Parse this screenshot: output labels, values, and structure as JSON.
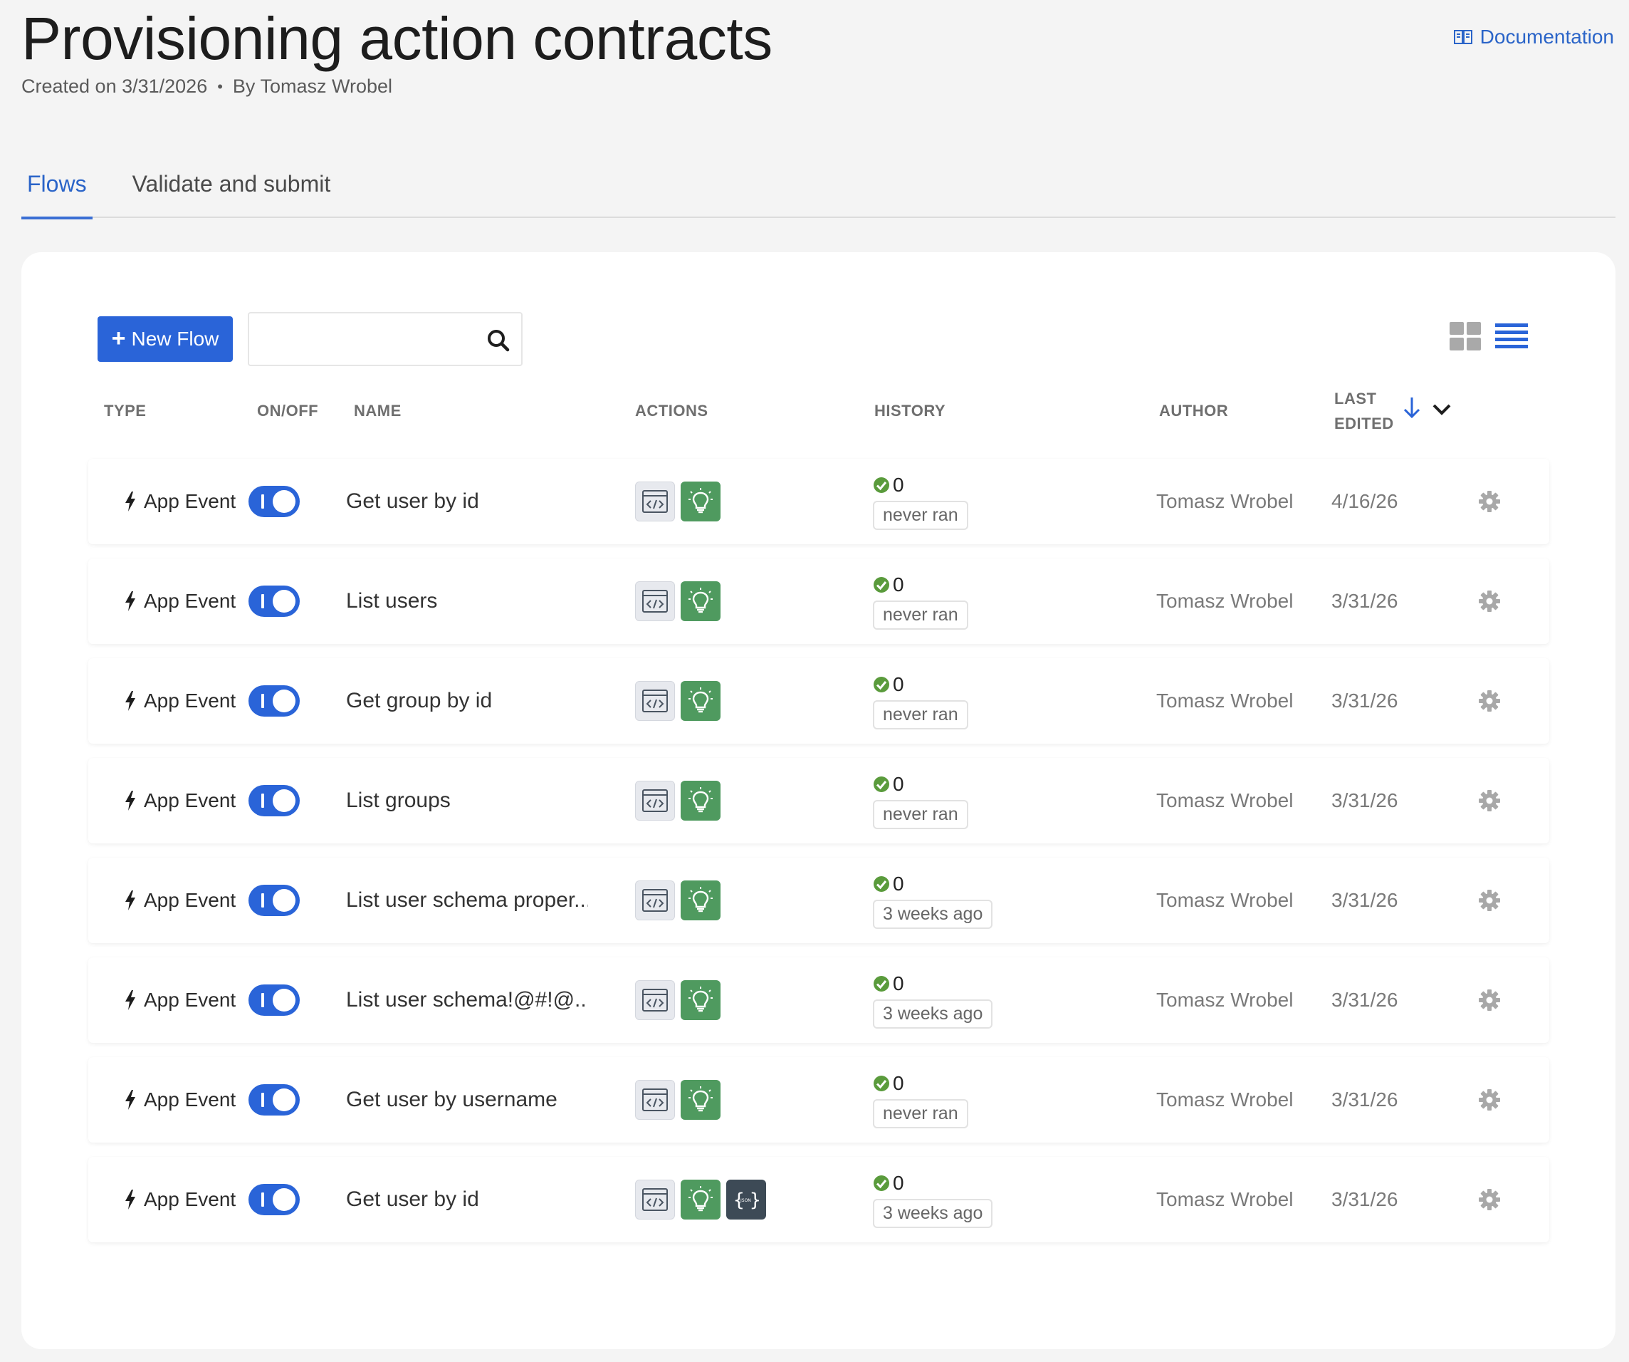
{
  "header": {
    "title": "Provisioning action contracts",
    "created": "Created on 3/31/2026",
    "separator": "•",
    "author": "By Tomasz Wrobel",
    "doc_link": "Documentation"
  },
  "tabs": [
    {
      "label": "Flows",
      "active": true
    },
    {
      "label": "Validate and submit",
      "active": false
    }
  ],
  "toolbar": {
    "new_flow_label": "New Flow",
    "search_placeholder": "",
    "view_mode": "list"
  },
  "table": {
    "columns": {
      "type": "TYPE",
      "onoff": "ON/OFF",
      "name": "NAME",
      "actions": "ACTIONS",
      "history": "HISTORY",
      "author": "AUTHOR",
      "last_edited_line1": "LAST",
      "last_edited_line2": "EDITED"
    },
    "sort": {
      "column": "last_edited",
      "direction": "desc"
    },
    "rows": [
      {
        "type": "App Event",
        "enabled": true,
        "name": "Get user by id",
        "actions": [
          "code",
          "bulb"
        ],
        "count": "0",
        "status": "never ran",
        "author": "Tomasz Wrobel",
        "edited": "4/16/26"
      },
      {
        "type": "App Event",
        "enabled": true,
        "name": "List users",
        "actions": [
          "code",
          "bulb"
        ],
        "count": "0",
        "status": "never ran",
        "author": "Tomasz Wrobel",
        "edited": "3/31/26"
      },
      {
        "type": "App Event",
        "enabled": true,
        "name": "Get group by id",
        "actions": [
          "code",
          "bulb"
        ],
        "count": "0",
        "status": "never ran",
        "author": "Tomasz Wrobel",
        "edited": "3/31/26"
      },
      {
        "type": "App Event",
        "enabled": true,
        "name": "List groups",
        "actions": [
          "code",
          "bulb"
        ],
        "count": "0",
        "status": "never ran",
        "author": "Tomasz Wrobel",
        "edited": "3/31/26"
      },
      {
        "type": "App Event",
        "enabled": true,
        "name": "List user schema proper...",
        "actions": [
          "code",
          "bulb"
        ],
        "count": "0",
        "status": "3 weeks ago",
        "author": "Tomasz Wrobel",
        "edited": "3/31/26"
      },
      {
        "type": "App Event",
        "enabled": true,
        "name": "List user schema!@#!@...",
        "actions": [
          "code",
          "bulb"
        ],
        "count": "0",
        "status": "3 weeks ago",
        "author": "Tomasz Wrobel",
        "edited": "3/31/26"
      },
      {
        "type": "App Event",
        "enabled": true,
        "name": "Get user by username",
        "actions": [
          "code",
          "bulb"
        ],
        "count": "0",
        "status": "never ran",
        "author": "Tomasz Wrobel",
        "edited": "3/31/26"
      },
      {
        "type": "App Event",
        "enabled": true,
        "name": "Get user by id",
        "actions": [
          "code",
          "bulb",
          "json"
        ],
        "count": "0",
        "status": "3 weeks ago",
        "author": "Tomasz Wrobel",
        "edited": "3/31/26"
      }
    ]
  },
  "icons": {
    "type": "bolt-icon",
    "code": "code-icon",
    "bulb": "lightbulb-icon",
    "json": "json-icon",
    "history_ok": "check-circle-icon",
    "row_menu": "gear-icon",
    "doc": "book-icon",
    "search": "search-icon"
  },
  "colors": {
    "accent": "#2a64d8",
    "bulb_green": "#4f9a5f",
    "json_dark": "#3d4a56",
    "check_green": "#5a9b3c",
    "background": "#f4f4f4"
  }
}
